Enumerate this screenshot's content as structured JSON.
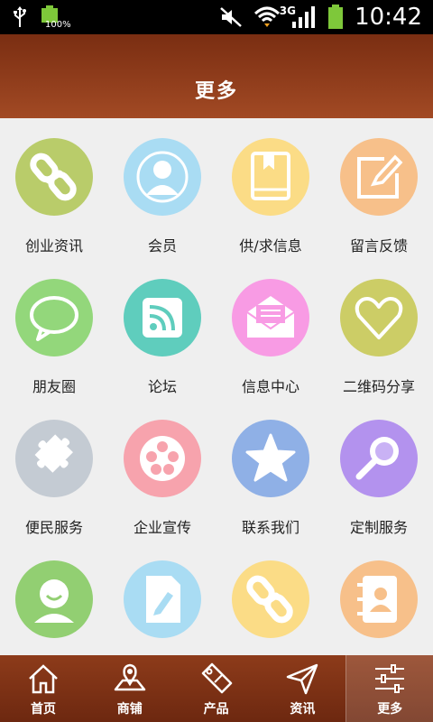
{
  "status_bar": {
    "battery_percent": "100%",
    "network": "3G",
    "time": "10:42"
  },
  "header": {
    "title": "更多"
  },
  "grid": {
    "items": [
      {
        "label": "创业资讯",
        "icon": "link-icon",
        "color": "#b9cc6a"
      },
      {
        "label": "会员",
        "icon": "user-icon",
        "color": "#a9dcf3"
      },
      {
        "label": "供/求信息",
        "icon": "book-icon",
        "color": "#fbdc86"
      },
      {
        "label": "留言反馈",
        "icon": "edit-icon",
        "color": "#f7c08a"
      },
      {
        "label": "朋友圈",
        "icon": "chat-bubble-icon",
        "color": "#93d77b"
      },
      {
        "label": "论坛",
        "icon": "rss-icon",
        "color": "#5fcdbd"
      },
      {
        "label": "信息中心",
        "icon": "mail-icon",
        "color": "#f89be4"
      },
      {
        "label": "二维码分享",
        "icon": "heart-icon",
        "color": "#cccd66"
      },
      {
        "label": "便民服务",
        "icon": "puzzle-icon",
        "color": "#c4cbd3"
      },
      {
        "label": "企业宣传",
        "icon": "film-reel-icon",
        "color": "#f7a3ad"
      },
      {
        "label": "联系我们",
        "icon": "star-icon",
        "color": "#8fb0e6"
      },
      {
        "label": "定制服务",
        "icon": "magnifier-icon",
        "color": "#b392ee"
      },
      {
        "label": "",
        "icon": "smiley-user-icon",
        "color": "#92cf72"
      },
      {
        "label": "",
        "icon": "document-pen-icon",
        "color": "#a9dcf3"
      },
      {
        "label": "",
        "icon": "link-icon",
        "color": "#fbdc86"
      },
      {
        "label": "",
        "icon": "contacts-book-icon",
        "color": "#f7c08a"
      }
    ]
  },
  "bottom_nav": {
    "items": [
      {
        "label": "首页",
        "icon": "home-icon"
      },
      {
        "label": "商铺",
        "icon": "map-icon"
      },
      {
        "label": "产品",
        "icon": "sale-tag-icon"
      },
      {
        "label": "资讯",
        "icon": "send-icon"
      },
      {
        "label": "更多",
        "icon": "settings-sliders-icon",
        "active": true
      }
    ]
  }
}
